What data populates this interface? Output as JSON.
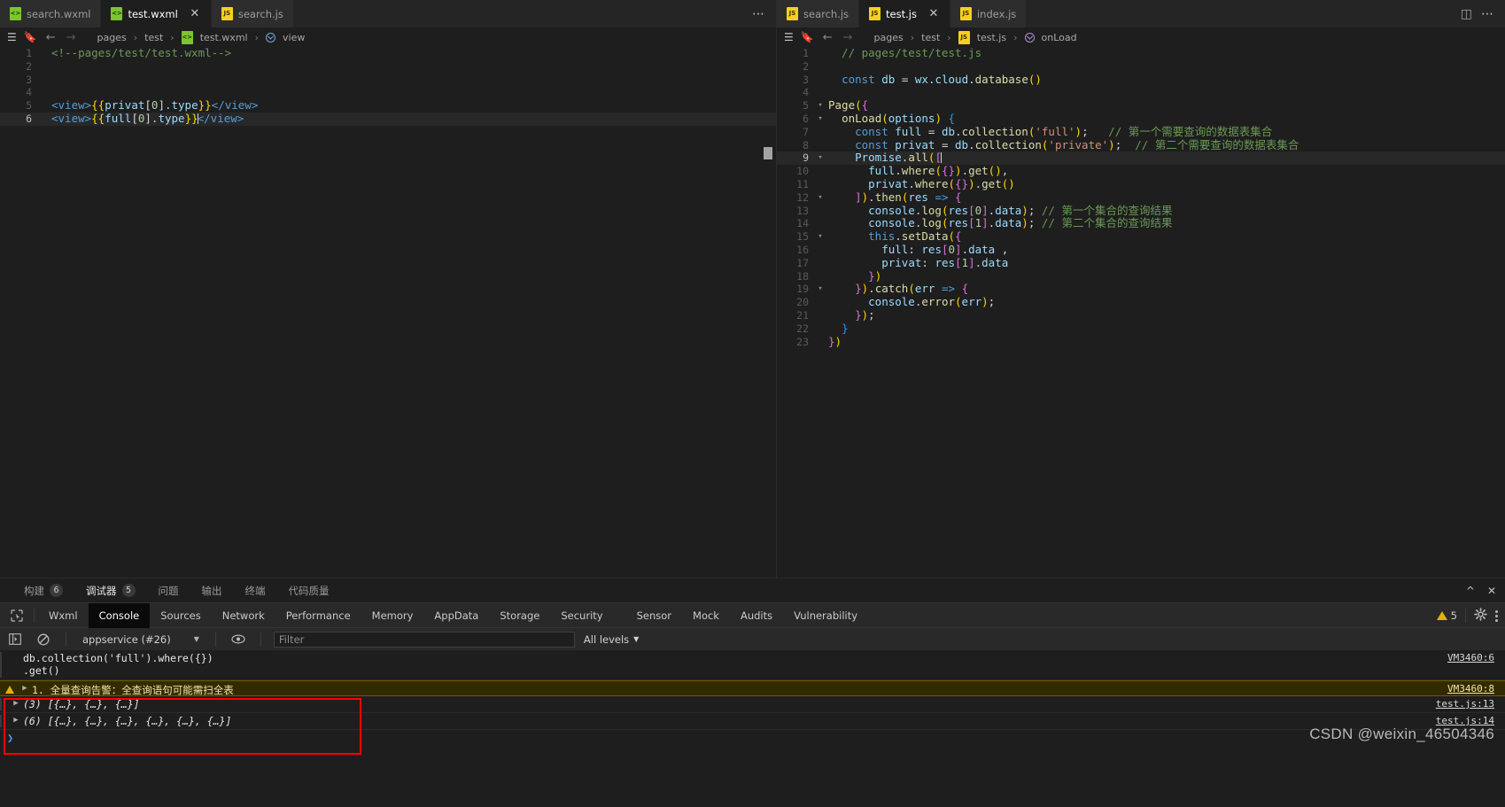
{
  "left_editor": {
    "tabs": [
      {
        "label": "search.wxml",
        "icon": "wxml-file-icon",
        "active": false,
        "closable": false
      },
      {
        "label": "test.wxml",
        "icon": "wxml-file-icon",
        "active": true,
        "closable": true
      },
      {
        "label": "search.js",
        "icon": "js-file-icon",
        "active": false,
        "closable": false
      }
    ],
    "tab_overflow": "⋯",
    "breadcrumb": {
      "outline_icon": "list-outline-icon",
      "bookmark_icon": "bookmark-icon",
      "back_icon": "arrow-left-icon",
      "forward_icon": "arrow-right-icon",
      "parts": [
        "pages",
        "test",
        "test.wxml",
        "view"
      ],
      "file_icon": "wxml-file-icon",
      "symbol_icon": "tag-symbol-icon"
    },
    "lines": [
      {
        "n": 1,
        "fold": "",
        "cur": false
      },
      {
        "n": 2,
        "fold": "",
        "cur": false
      },
      {
        "n": 3,
        "fold": "",
        "cur": false
      },
      {
        "n": 4,
        "fold": "",
        "cur": false
      },
      {
        "n": 5,
        "fold": "",
        "cur": false
      },
      {
        "n": 6,
        "fold": "",
        "cur": true
      }
    ],
    "code_text": [
      "<!--pages/test/test.wxml-->",
      "",
      "",
      "",
      "<view>{{privat[0].type}}</view>",
      "<view>{{full[0].type}}</view>"
    ]
  },
  "right_editor": {
    "tabs": [
      {
        "label": "search.js",
        "icon": "js-file-icon",
        "active": false,
        "closable": false
      },
      {
        "label": "test.js",
        "icon": "js-file-icon",
        "active": true,
        "closable": true
      },
      {
        "label": "index.js",
        "icon": "js-file-icon",
        "active": false,
        "closable": false
      }
    ],
    "split_icon": "split-editor-icon",
    "more_icon": "more-actions-icon",
    "breadcrumb": {
      "outline_icon": "list-outline-icon",
      "bookmark_icon": "bookmark-icon",
      "back_icon": "arrow-left-icon",
      "forward_icon": "arrow-right-icon",
      "parts": [
        "pages",
        "test",
        "test.js",
        "onLoad"
      ],
      "file_icon": "js-file-icon",
      "symbol_icon": "method-symbol-icon"
    },
    "lines": [
      {
        "n": 1,
        "fold": "",
        "cur": false
      },
      {
        "n": 2,
        "fold": "",
        "cur": false
      },
      {
        "n": 3,
        "fold": "",
        "cur": false
      },
      {
        "n": 4,
        "fold": "",
        "cur": false
      },
      {
        "n": 5,
        "fold": "v",
        "cur": false
      },
      {
        "n": 6,
        "fold": "v",
        "cur": false
      },
      {
        "n": 7,
        "fold": "",
        "cur": false
      },
      {
        "n": 8,
        "fold": "",
        "cur": false
      },
      {
        "n": 9,
        "fold": "v",
        "cur": true
      },
      {
        "n": 10,
        "fold": "",
        "cur": false
      },
      {
        "n": 11,
        "fold": "",
        "cur": false
      },
      {
        "n": 12,
        "fold": "v",
        "cur": false
      },
      {
        "n": 13,
        "fold": "",
        "cur": false
      },
      {
        "n": 14,
        "fold": "",
        "cur": false
      },
      {
        "n": 15,
        "fold": "v",
        "cur": false
      },
      {
        "n": 16,
        "fold": "",
        "cur": false
      },
      {
        "n": 17,
        "fold": "",
        "cur": false
      },
      {
        "n": 18,
        "fold": "",
        "cur": false
      },
      {
        "n": 19,
        "fold": "v",
        "cur": false
      },
      {
        "n": 20,
        "fold": "",
        "cur": false
      },
      {
        "n": 21,
        "fold": "",
        "cur": false
      },
      {
        "n": 22,
        "fold": "",
        "cur": false
      },
      {
        "n": 23,
        "fold": "",
        "cur": false
      }
    ],
    "code_text": [
      "// pages/test/test.js",
      "",
      "const db = wx.cloud.database()",
      "",
      "Page({",
      "  onLoad(options) {",
      "    const full = db.collection('full');    // 第一个需要查询的数据表集合",
      "    const privat = db.collection('private');  // 第二个需要查询的数据表集合",
      "    Promise.all([",
      "      full.where({}).get(),",
      "      privat.where({}).get()",
      "    ]).then(res => {",
      "      console.log(res[0].data); // 第一个集合的查询结果",
      "      console.log(res[1].data); // 第二个集合的查询结果",
      "      this.setData({",
      "        full: res[0].data ,",
      "        privat: res[1].data",
      "      })",
      "    }).catch(err => {",
      "      console.error(err);",
      "    });",
      "  }",
      "})"
    ]
  },
  "panel": {
    "tabs": [
      {
        "label": "构建",
        "badge": "6",
        "active": false
      },
      {
        "label": "调试器",
        "badge": "5",
        "active": true
      },
      {
        "label": "问题",
        "badge": "",
        "active": false
      },
      {
        "label": "输出",
        "badge": "",
        "active": false
      },
      {
        "label": "终端",
        "badge": "",
        "active": false
      },
      {
        "label": "代码质量",
        "badge": "",
        "active": false
      }
    ],
    "collapse_icon": "chevron-up-icon",
    "close_icon": "close-icon"
  },
  "devtools": {
    "inspect_icon": "inspect-element-icon",
    "tabs": [
      {
        "label": "Wxml",
        "active": false
      },
      {
        "label": "Console",
        "active": true
      },
      {
        "label": "Sources",
        "active": false
      },
      {
        "label": "Network",
        "active": false
      },
      {
        "label": "Performance",
        "active": false
      },
      {
        "label": "Memory",
        "active": false
      },
      {
        "label": "AppData",
        "active": false
      },
      {
        "label": "Storage",
        "active": false
      },
      {
        "label": "Security",
        "active": false
      },
      {
        "label": "Sensor",
        "active": false
      },
      {
        "label": "Mock",
        "active": false
      },
      {
        "label": "Audits",
        "active": false
      },
      {
        "label": "Vulnerability",
        "active": false
      }
    ],
    "warning_count": "5",
    "warning_icon": "warning-triangle-icon",
    "settings_icon": "gear-icon",
    "menu_icon": "kebab-menu-icon"
  },
  "console_toolbar": {
    "sidebar_icon": "show-console-sidebar-icon",
    "clear_icon": "clear-console-icon",
    "context": "appservice (#26)",
    "context_caret": "▼",
    "eye_icon": "live-expression-icon",
    "filter_placeholder": "Filter",
    "filter_value": "",
    "levels_label": "All levels",
    "levels_caret": "▼"
  },
  "console_rows": [
    {
      "kind": "source",
      "text": "db.collection('full').where({})\n.get()",
      "link": "VM3460:6",
      "expandable": false,
      "warn": false
    },
    {
      "kind": "warning",
      "text": "1. 全量查询告警：全查询语句可能需扫全表",
      "link": "VM3460:8",
      "expandable": true,
      "warn": true
    },
    {
      "kind": "log",
      "text": "(3) [{…}, {…}, {…}]",
      "link": "test.js:13",
      "expandable": true,
      "warn": false
    },
    {
      "kind": "log",
      "text": "(6) [{…}, {…}, {…}, {…}, {…}, {…}]",
      "link": "test.js:14",
      "expandable": true,
      "warn": false
    },
    {
      "kind": "prompt",
      "text": "",
      "link": "",
      "expandable": false,
      "warn": false
    }
  ],
  "watermark": "CSDN @weixin_46504346",
  "colors": {
    "editor_bg": "#1e1e1e",
    "tab_bg": "#2d2d2d",
    "accent_red": "#ff0000",
    "warn_yellow": "#e2b007",
    "warn_row_bg": "#332b00"
  }
}
